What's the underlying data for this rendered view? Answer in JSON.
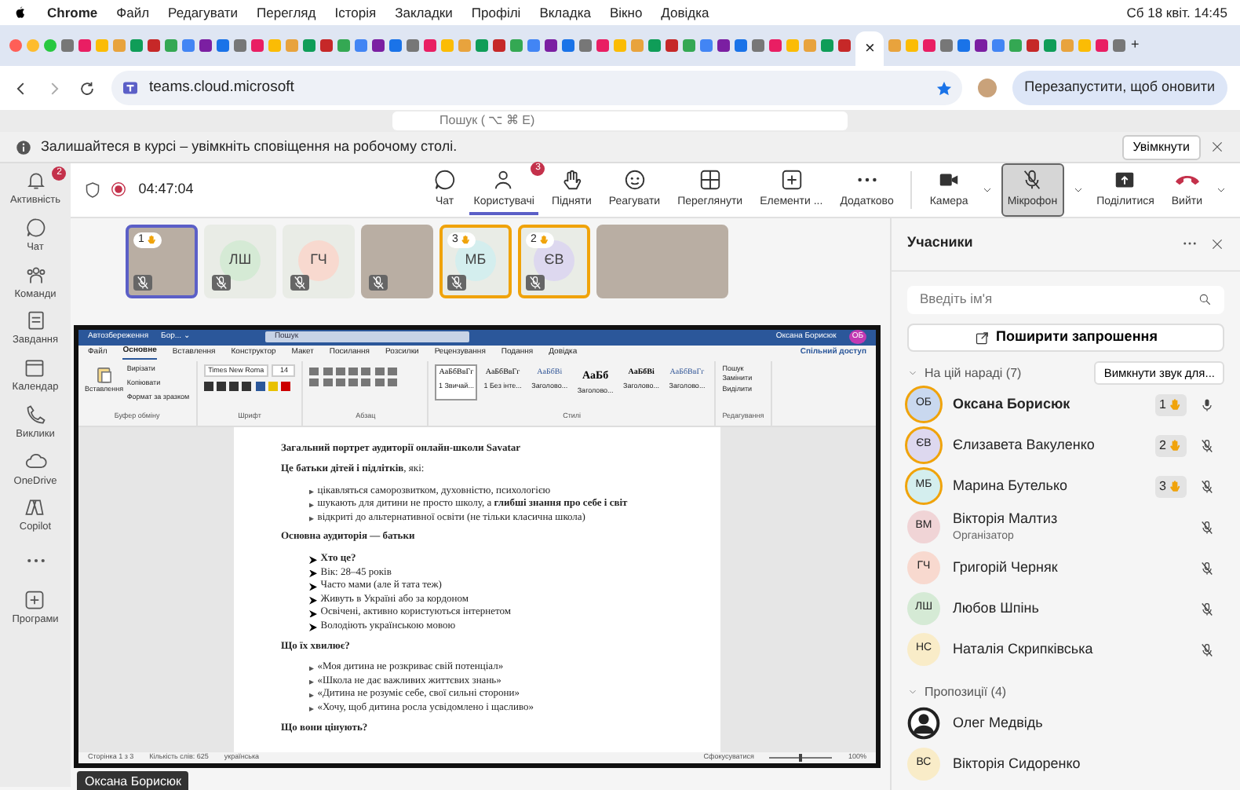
{
  "menubar": {
    "app": "Chrome",
    "menus": [
      "Файл",
      "Редагувати",
      "Перегляд",
      "Історія",
      "Закладки",
      "Профілі",
      "Вкладка",
      "Вікно",
      "Довідка"
    ],
    "clock": "Сб 18 квіт. 14:45"
  },
  "browser": {
    "close_tab": "×",
    "new_tab": "+",
    "url": "teams.cloud.microsoft",
    "update_button": "Перезапустити, щоб оновити"
  },
  "teams_search": {
    "placeholder": "Пошук ( ⌥ ⌘ E)"
  },
  "notice": {
    "text": "Залишайтеся в курсі – увімкніть сповіщення на робочому столі.",
    "button": "Увімкнути"
  },
  "rail": [
    {
      "kind": "bell",
      "label": "Активність",
      "badge": "2"
    },
    {
      "kind": "chat",
      "label": "Чат"
    },
    {
      "kind": "teams",
      "label": "Команди"
    },
    {
      "kind": "tasks",
      "label": "Завдання"
    },
    {
      "kind": "calendar",
      "label": "Календар"
    },
    {
      "kind": "call",
      "label": "Виклики"
    },
    {
      "kind": "cloud",
      "label": "OneDrive"
    },
    {
      "kind": "copilot",
      "label": "Copilot"
    },
    {
      "kind": "more"
    },
    {
      "kind": "apps",
      "label": "Програми"
    }
  ],
  "meeting": {
    "timer": "04:47:04",
    "recording": true,
    "actions": [
      {
        "kind": "chat",
        "label": "Чат",
        "selected": false
      },
      {
        "kind": "people",
        "label": "Користувачі",
        "badge": "3",
        "selected": true
      },
      {
        "kind": "hand",
        "label": "Підняти",
        "selected": false
      },
      {
        "kind": "react",
        "label": "Реагувати",
        "selected": false
      },
      {
        "kind": "view",
        "label": "Переглянути",
        "selected": false
      },
      {
        "kind": "apps",
        "label": "Елементи ...",
        "selected": false
      },
      {
        "kind": "more",
        "label": "Додатково",
        "selected": false
      }
    ],
    "devices": [
      {
        "kind": "camera",
        "label": "Камера",
        "selected": false
      },
      {
        "kind": "mic",
        "label": "Мікрофон",
        "selected": true
      },
      {
        "kind": "share",
        "label": "Поділитися",
        "selected": false
      },
      {
        "kind": "leave",
        "label": "Вийти",
        "selected": false
      }
    ]
  },
  "tiles": [
    {
      "kind": "photo",
      "hand": "1",
      "speaking": true,
      "muted": true
    },
    {
      "kind": "initials",
      "initials": "ЛШ",
      "color": "#d5ead5",
      "speaking": false,
      "muted": true
    },
    {
      "kind": "initials",
      "initials": "ГЧ",
      "color": "#f8d9cf",
      "speaking": false,
      "muted": true
    },
    {
      "kind": "photo",
      "speaking": false,
      "muted": true
    },
    {
      "kind": "initials",
      "initials": "МБ",
      "color": "#d4eeee",
      "hand": "3",
      "speaking": false,
      "muted": true
    },
    {
      "kind": "initials",
      "initials": "ЄВ",
      "color": "#ddd8ef",
      "hand": "2",
      "speaking": false,
      "muted": true
    },
    {
      "kind": "wide-photo",
      "speaking": false,
      "muted": false
    }
  ],
  "share": {
    "presenter": "Оксана Борисюк",
    "word": {
      "autosave": "Автозбереження",
      "doc_name": "Бор... ⌄",
      "search": "Пошук",
      "user": "Оксана Борисюк",
      "user_initials": "ОБ",
      "tabs": [
        {
          "label": "Файл",
          "selected": false
        },
        {
          "label": "Основне",
          "selected": true
        },
        {
          "label": "Вставлення",
          "selected": false
        },
        {
          "label": "Конструктор",
          "selected": false
        },
        {
          "label": "Макет",
          "selected": false
        },
        {
          "label": "Посилання",
          "selected": false
        },
        {
          "label": "Розсилки",
          "selected": false
        },
        {
          "label": "Рецензування",
          "selected": false
        },
        {
          "label": "Подання",
          "selected": false
        },
        {
          "label": "Довідка",
          "selected": false
        }
      ],
      "share_button": "Спільний доступ",
      "clipboard": {
        "paste": "Вставлення",
        "items": [
          "Вирізати",
          "Копіювати",
          "Формат за зразком"
        ],
        "group": "Буфер обміну"
      },
      "font": {
        "name": "Times New Roma",
        "size": "14",
        "group": "Шрифт"
      },
      "paragraph": {
        "group": "Абзац"
      },
      "styles": {
        "group": "Стилі",
        "items": [
          {
            "sample": "AaБбВвГг",
            "name": "1 Звичай...",
            "selected": true
          },
          {
            "sample": "AaБбВвГг",
            "name": "1 Без інте...",
            "selected": false
          },
          {
            "sample": "AaБбВі",
            "name": "Заголово...",
            "selected": false
          },
          {
            "sample": "AaБб",
            "name": "Заголово...",
            "selected": false
          },
          {
            "sample": "AaБбВі",
            "name": "Заголово...",
            "selected": false
          },
          {
            "sample": "AaБбВвГг",
            "name": "Заголово...",
            "selected": false
          }
        ]
      },
      "editing": {
        "group": "Редагування",
        "items": [
          "Пошук",
          "Замінити",
          "Виділити"
        ]
      },
      "body": [
        {
          "kind": "heading",
          "text": "Загальний портрет аудиторії онлайн-школи Savatar"
        },
        {
          "kind": "para",
          "text": "**Це батьки дітей і підлітків**, які:"
        },
        {
          "kind": "bullet-list",
          "items": [
            {
              "text": "цікавляться саморозвитком, духовністю, психологією",
              "bold": false
            },
            {
              "text": "шукають для дитини не просто школу, а **глибші знання про себе і світ**",
              "bold": false
            },
            {
              "text": "відкриті до альтернативної освіти (не тільки класична школа)",
              "bold": false
            }
          ]
        },
        {
          "kind": "heading",
          "text": "Основна аудиторія — батьки"
        },
        {
          "kind": "arrow-list",
          "items": [
            {
              "text": "Хто це?",
              "bold": true
            },
            {
              "text": "Вік: 28–45 років",
              "bold": false
            },
            {
              "text": "Часто мами (але й тата теж)",
              "bold": false
            },
            {
              "text": "Живуть в Україні або за кордоном",
              "bold": false
            },
            {
              "text": "Освічені, активно користуються інтернетом",
              "bold": false
            },
            {
              "text": "Володіють українською мовою",
              "bold": false
            }
          ]
        },
        {
          "kind": "heading",
          "text": "Що їх хвилює?"
        },
        {
          "kind": "bullet-list",
          "items": [
            {
              "text": "«Моя дитина не розкриває свій потенціал»",
              "bold": false
            },
            {
              "text": "«Школа не дає важливих життєвих знань»",
              "bold": false
            },
            {
              "text": "«Дитина не розуміє себе, свої сильні сторони»",
              "bold": false
            },
            {
              "text": "«Хочу, щоб дитина росла усвідомлено і щасливо»",
              "bold": false
            }
          ]
        },
        {
          "kind": "heading",
          "text": "Що вони цінують?"
        }
      ],
      "status": {
        "page": "Сторінка 1 з 3",
        "words": "Кількість слів: 625",
        "lang": "українська",
        "focus": "Сфокусуватися",
        "zoom": "100%",
        "zoom_slider": {
          "level": 0.5
        }
      }
    }
  },
  "panel": {
    "title": "Учасники",
    "search_placeholder": "Введіть ім'я",
    "invite": "Поширити запрошення",
    "sections": [
      {
        "title": "На цій нараді (7)",
        "expanded": true,
        "action": "Вимкнути звук для...",
        "people": [
          {
            "kind": "initials",
            "initials": "ОБ",
            "name": "Оксана Борисюк",
            "color": "#c9d8ef",
            "hand": "1",
            "speaking": true,
            "muted": false
          },
          {
            "kind": "initials",
            "initials": "ЄВ",
            "name": "Єлизавета Вакуленко",
            "color": "#ddd8ef",
            "hand": "2",
            "speaking": false,
            "muted": true
          },
          {
            "kind": "initials",
            "initials": "МБ",
            "name": "Марина Бутелько",
            "color": "#d4eeee",
            "hand": "3",
            "speaking": false,
            "muted": true
          },
          {
            "kind": "initials",
            "initials": "ВМ",
            "name": "Вікторія Малтиз",
            "role": "Організатор",
            "color": "#f0d4d6",
            "speaking": false,
            "muted": true
          },
          {
            "kind": "initials",
            "initials": "ГЧ",
            "name": "Григорій Черняк",
            "color": "#f8d9cf",
            "speaking": false,
            "muted": true
          },
          {
            "kind": "initials",
            "initials": "ЛШ",
            "name": "Любов Шпінь",
            "color": "#d5ead5",
            "speaking": false,
            "muted": true
          },
          {
            "kind": "initials",
            "initials": "НС",
            "name": "Наталія Скрипківська",
            "color": "#f9ecc8",
            "speaking": false,
            "muted": true
          }
        ]
      },
      {
        "title": "Пропозиції (4)",
        "expanded": true,
        "people": [
          {
            "kind": "photo",
            "name": "Олег Медвідь",
            "speaking": false
          },
          {
            "kind": "initials",
            "initials": "ВС",
            "name": "Вікторія Сидоренко",
            "color": "#f9ecc8",
            "speaking": false
          }
        ]
      }
    ]
  }
}
